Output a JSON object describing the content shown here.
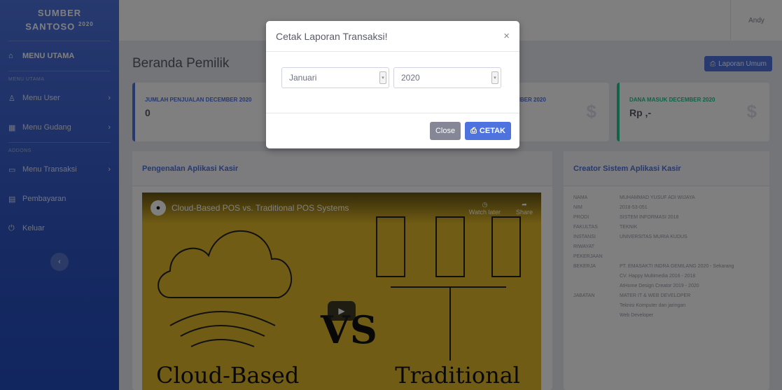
{
  "brand": {
    "line1": "SUMBER",
    "line2": "SANTOSO",
    "year": "2020"
  },
  "sidebar": {
    "dashboard": "MENU UTAMA",
    "heading1": "MENU UTAMA",
    "heading2": "ADDONS",
    "items": [
      {
        "label": "Menu User",
        "icon": "user-icon"
      },
      {
        "label": "Menu Gudang",
        "icon": "warehouse-icon"
      },
      {
        "label": "Menu Transaksi",
        "icon": "transaction-icon"
      },
      {
        "label": "Pembayaran",
        "icon": "payment-icon"
      },
      {
        "label": "Keluar",
        "icon": "logout-icon"
      }
    ]
  },
  "topbar": {
    "user": "Andy"
  },
  "page": {
    "title": "Beranda Pemilik",
    "report_button": "Laporan Umum"
  },
  "cards": [
    {
      "label": "JUMLAH PENJUALAN DECEMBER 2020",
      "value": "0"
    },
    {
      "label": "DECEMBER 2020",
      "value": ""
    },
    {
      "label": "DANA MASUK DECEMBER 2020",
      "value": "Rp ,-"
    }
  ],
  "panels": {
    "left_title": "Pengenalan Aplikasi Kasir",
    "right_title": "Creator Sistem Aplikasi Kasir"
  },
  "video": {
    "title": "Cloud-Based POS vs. Traditional POS Systems",
    "watch_later": "Watch later",
    "share": "Share",
    "caption_left": "Cloud-Based",
    "caption_right": "Traditional"
  },
  "creator": [
    {
      "k": "NAMA",
      "v": "MUHAMMAD YUSUF ADI WIJAYA"
    },
    {
      "k": "NIM",
      "v": "2018-53-051"
    },
    {
      "k": "PRODI",
      "v": "SISTEM INFORMASI 2018"
    },
    {
      "k": "FAKULTAS",
      "v": "TEKNIK"
    },
    {
      "k": "INSTANSI",
      "v": "UNIVERSITAS MURIA KUDUS"
    },
    {
      "k": "RIWAYAT",
      "v": ""
    },
    {
      "k": "PEKERJAAN",
      "v": ""
    },
    {
      "k": "BEKERJA",
      "v": "PT. EMASAKTI INDRA GEMILANG 2020 - Sekarang"
    },
    {
      "k": "",
      "v": "CV. Happy Multimedia 2016 - 2018"
    },
    {
      "k": "",
      "v": "AtHome Design Creator 2019 - 2020"
    },
    {
      "k": "JABATAN",
      "v": "MATER IT & WEB DEVELOPER"
    },
    {
      "k": "",
      "v": "Teknisi Komputer dan jaringan"
    },
    {
      "k": "",
      "v": "Web Developer"
    }
  ],
  "modal": {
    "title": "Cetak Laporan Transaksi!",
    "close_x": "×",
    "month": "Januari",
    "year": "2020",
    "close_button": "Close",
    "print_button": "CETAK"
  }
}
